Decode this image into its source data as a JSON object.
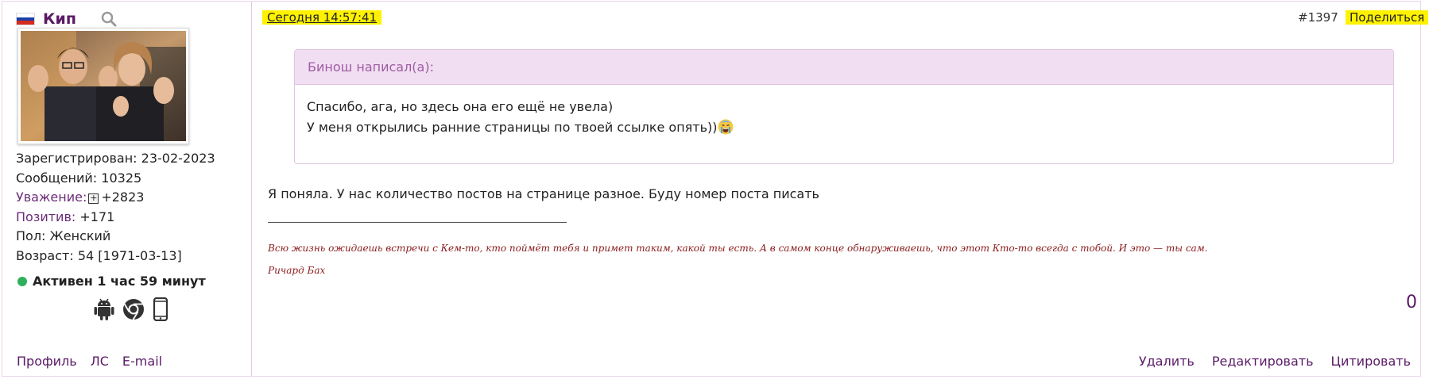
{
  "user": {
    "flag": "russia-flag",
    "name": "Кип",
    "info": {
      "registered_label": "Зарегистрирован:",
      "registered_value": "23-02-2023",
      "messages_label": "Сообщений:",
      "messages_value": "10325",
      "respect_label": "Уважение:",
      "respect_value": "+2823",
      "positive_label": "Позитив:",
      "positive_value": "+171",
      "gender_label": "Пол:",
      "gender_value": "Женский",
      "age_label": "Возраст:",
      "age_value": "54 [1971-03-13]"
    },
    "status": "Активен 1 час 59 минут",
    "status_color": "#2fb05c",
    "devices": [
      "android-icon",
      "chrome-icon",
      "mobile-phone-icon"
    ],
    "links": {
      "profile": "Профиль",
      "pm": "ЛС",
      "email": "E-mail"
    }
  },
  "post": {
    "timestamp": "Сегодня 14:57:41",
    "number": "#1397",
    "share": "Поделиться",
    "quote": {
      "author": "Бинош написал(а):",
      "line1": "Спасибо, ага, но здесь она его ещё не увела)",
      "line2": "У меня открылись ранние страницы по твоей ссылке опять))",
      "emoji": "crying-face-emoji"
    },
    "message": "Я поняла. У нас количество постов на странице разное. Буду номер поста писать",
    "signature": {
      "quote": "Всю жизнь ожидаешь встречи с Кем-то, кто поймёт тебя и примет таким, какой ты есть. А в самом конце обнаруживаешь, что этот Кто-то всегда с тобой. И это — ты сам.",
      "author": "Ричард Бах"
    },
    "reputation": "0",
    "actions": {
      "delete": "Удалить",
      "edit": "Редактировать",
      "quote": "Цитировать"
    }
  },
  "colors": {
    "accent": "#5a1a66",
    "highlight": "#fff200",
    "quote_header_bg": "#f2def2",
    "signature": "#8b1c1c"
  }
}
